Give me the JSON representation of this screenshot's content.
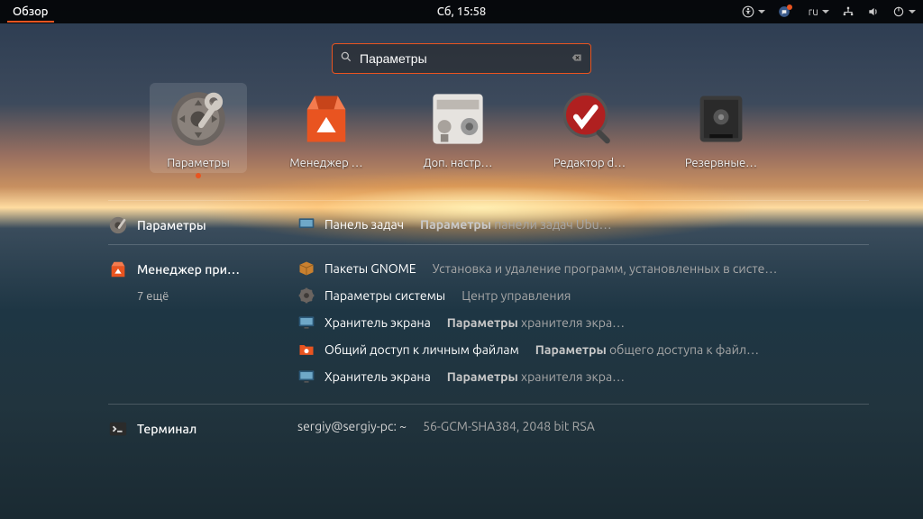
{
  "topbar": {
    "overview": "Обзор",
    "clock": "Сб, 15:58",
    "lang": "ru"
  },
  "search": {
    "value": "Параметры"
  },
  "apps": [
    {
      "id": "settings",
      "label": "Параметры",
      "selected": true
    },
    {
      "id": "software",
      "label": "Менеджер …"
    },
    {
      "id": "tweaks",
      "label": "Доп. настр…"
    },
    {
      "id": "dconf",
      "label": "Редактор d…"
    },
    {
      "id": "backups",
      "label": "Резервные…"
    }
  ],
  "groups": [
    {
      "src": {
        "icon": "settings",
        "name": "Параметры"
      },
      "items": [
        {
          "icon": "monitor",
          "title": "Панель задач",
          "desc_prefix": "Параметры",
          "desc_rest": " панели задач Ubu…"
        }
      ]
    },
    {
      "src": {
        "icon": "software",
        "name": "Менеджер при…",
        "more": "7 ещё"
      },
      "items": [
        {
          "icon": "package",
          "title": "Пакеты GNOME",
          "desc_prefix": "",
          "desc_rest": "Установка и удаление программ, установленных в систе…"
        },
        {
          "icon": "gear",
          "title": "Параметры системы",
          "desc_prefix": "",
          "desc_rest": "Центр управления"
        },
        {
          "icon": "monitor",
          "title": "Хранитель экрана",
          "desc_prefix": "Параметры",
          "desc_rest": " хранителя экра…"
        },
        {
          "icon": "share",
          "title": "Общий доступ к личным файлам",
          "desc_prefix": "Параметры",
          "desc_rest": " общего доступа к файл…"
        },
        {
          "icon": "monitor",
          "title": "Хранитель экрана",
          "desc_prefix": "Параметры",
          "desc_rest": " хранителя экра…"
        }
      ]
    },
    {
      "src": {
        "icon": "terminal",
        "name": "Терминал"
      },
      "items": [
        {
          "icon": "",
          "title": "sergiy@sergiy-pc: ~",
          "desc_prefix": "",
          "desc_rest": "56-GCM-SHA384, 2048 bit RSA"
        }
      ],
      "terminal": true
    }
  ]
}
